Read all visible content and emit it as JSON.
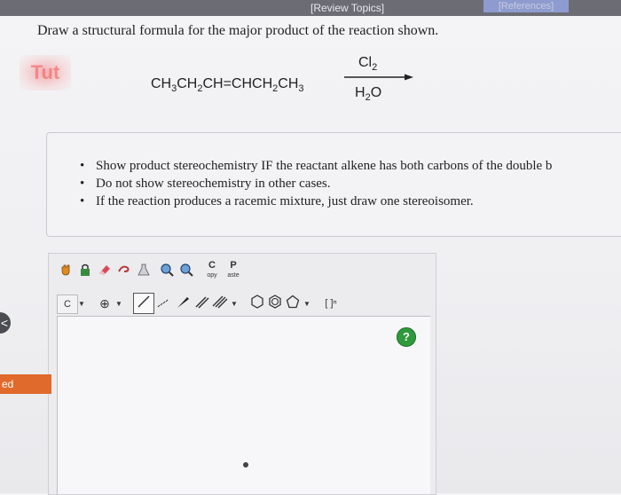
{
  "header": {
    "review_topics": "[Review Topics]",
    "references": "[References]"
  },
  "question": {
    "prompt": "Draw a structural formula for the major product of the reaction shown.",
    "badge": "Tut",
    "reaction": {
      "reactant_html": "CH<sub>3</sub>CH<sub>2</sub>CH=CHCH<sub>2</sub>CH<sub>3</sub>",
      "reagent_top_html": "Cl<sub>2</sub>",
      "reagent_bottom_html": "H<sub>2</sub>O"
    }
  },
  "hints": [
    "Show product stereochemistry IF the reactant alkene has both carbons of the double b",
    "Do not show stereochemistry in other cases.",
    "If the reaction produces a racemic mixture, just draw one stereoisomer."
  ],
  "editor": {
    "toolbar_row1": [
      {
        "name": "hand-tool",
        "icon": "hand-icon"
      },
      {
        "name": "lock-tool",
        "icon": "lock-icon"
      },
      {
        "name": "eraser-tool",
        "icon": "eraser-icon"
      },
      {
        "name": "lasso-tool",
        "icon": "lasso-icon"
      },
      {
        "name": "flask-tool",
        "icon": "flask-icon"
      },
      {
        "name": "zoom-in-tool",
        "icon": "zoom-in-icon"
      },
      {
        "name": "zoom-out-tool",
        "icon": "zoom-out-icon"
      }
    ],
    "copy_label": "C",
    "copy_sub": "opy",
    "paste_label": "P",
    "paste_sub": "aste",
    "element_label": "C",
    "charge_label": "⊕",
    "bracket_label": "[ ]ⁿ",
    "help_label": "?"
  },
  "sidebar": {
    "orange_tab": "ed",
    "nav_label": "<"
  },
  "colors": {
    "accent_orange": "#e06a2c",
    "help_green": "#2f9a3c",
    "topbar": "#6c6d74"
  }
}
